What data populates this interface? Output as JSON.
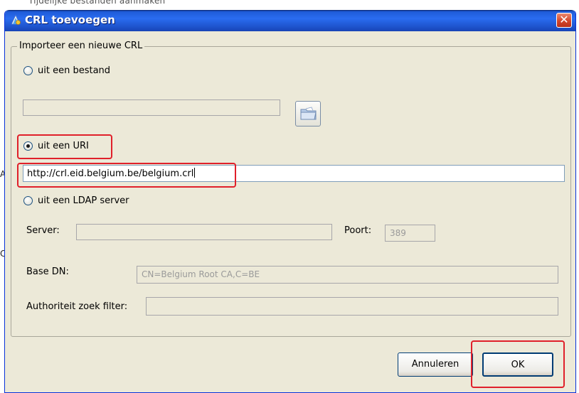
{
  "background": {
    "top_text": "Tijdelijke bestanden aanmaken",
    "left_letter_a": "A",
    "left_letter_c": "C"
  },
  "dialog": {
    "title": "CRL toevoegen",
    "close_glyph": "✕",
    "group_title": "Importeer een nieuwe CRL",
    "file_option": {
      "label": "uit een bestand",
      "checked": false,
      "path_value": ""
    },
    "uri_option": {
      "label": "uit een URI",
      "checked": true,
      "value": "http://crl.eid.belgium.be/belgium.crl"
    },
    "ldap_option": {
      "label": "uit een LDAP server",
      "checked": false,
      "server_label": "Server:",
      "server_value": "",
      "port_label": "Poort:",
      "port_value": "389",
      "base_dn_label": "Base DN:",
      "base_dn_value": "CN=Belgium Root CA,C=BE",
      "filter_label": "Authoriteit zoek filter:",
      "filter_value": ""
    },
    "buttons": {
      "cancel": "Annuleren",
      "ok": "OK"
    }
  },
  "icons": {
    "title_icon": "certificate-icon",
    "browse_icon": "open-folder-icon"
  },
  "colors": {
    "titlebar": "#2a6cf0",
    "dialog_bg": "#ece9d8",
    "highlight": "#e0202a",
    "close_button": "#d3462a"
  }
}
